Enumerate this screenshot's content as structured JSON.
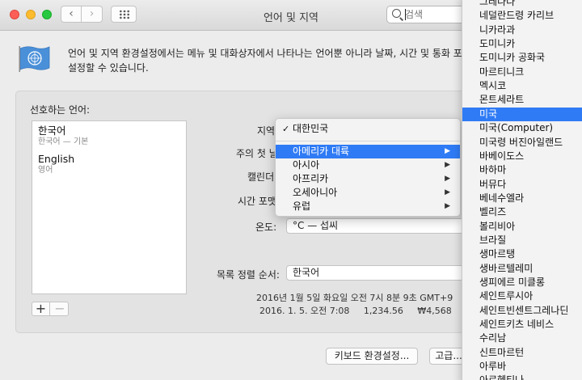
{
  "window": {
    "title": "언어 및 지역"
  },
  "search": {
    "placeholder": "검색"
  },
  "header": {
    "line1": "언어 및 지역 환경설정에서는 메뉴 및 대화상자에서 나타나는 언어뿐 아니라 날짜, 시간 및 통화 포맷",
    "line2": "설정할 수 있습니다."
  },
  "preferred": {
    "label": "선호하는 언어:",
    "languages": [
      {
        "name": "한국어",
        "sub": "한국어 — 기본"
      },
      {
        "name": "English",
        "sub": "영어"
      }
    ],
    "add": "+",
    "remove": "−"
  },
  "fields": {
    "region_label": "지역",
    "first_day_label": "주의 첫 날",
    "calendar_label": "캘린더",
    "time_format_label": "시간 포맷",
    "temperature_label": "온도:",
    "temperature_value": "°C — 섭씨",
    "sort_label": "목록 정렬 순서:",
    "sort_value": "한국어"
  },
  "format_preview": {
    "line1": "2016년 1월 5일 화요일 오전 7시 8분 9초 GMT+9",
    "line2": "2016. 1. 5. 오전 7:08     1,234.56     ₩4,568"
  },
  "buttons": {
    "keyboard": "키보드 환경설정...",
    "advanced": "고급..."
  },
  "region_menu": {
    "selected": "대한민국",
    "items": [
      "아메리카 대륙",
      "아시아",
      "아프리카",
      "오세아니아",
      "유럽"
    ],
    "highlighted": "아메리카 대륙"
  },
  "country_menu": {
    "items": [
      "그레나다",
      "네덜란드령 카리브",
      "니카라과",
      "도미니카",
      "도미니카 공화국",
      "마르티니크",
      "멕시코",
      "몬트세라트",
      "미국",
      "미국(Computer)",
      "미국령 버진아일랜드",
      "바베이도스",
      "바하마",
      "버뮤다",
      "베네수엘라",
      "벨리즈",
      "볼리비아",
      "브라질",
      "생마르탱",
      "생바르텔레미",
      "생피에르 미클롱",
      "세인트루시아",
      "세인트빈센트그레나딘",
      "세인트키츠 네비스",
      "수리남",
      "신트마르턴",
      "아루바",
      "아르헨티나"
    ],
    "highlighted": "미국"
  },
  "colors": {
    "highlight": "#2f7bf5",
    "flag_blue": "#4a90d9"
  }
}
